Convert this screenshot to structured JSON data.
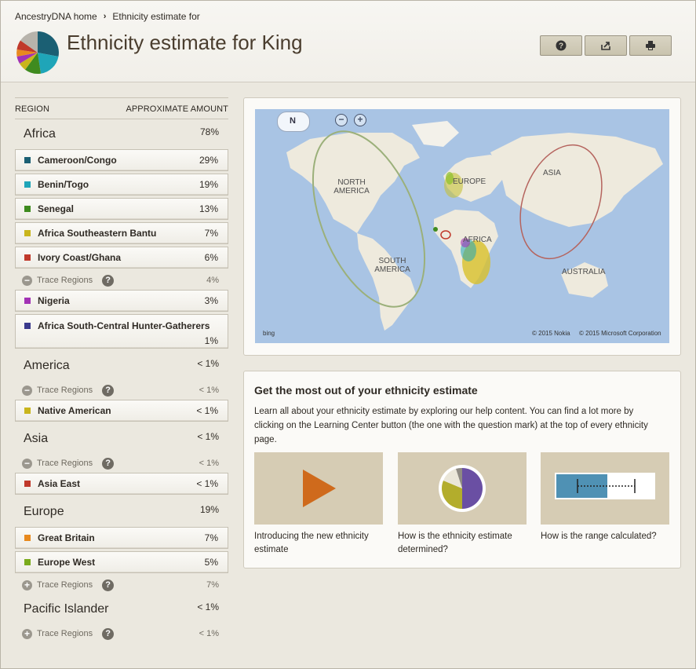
{
  "breadcrumb": {
    "home": "AncestryDNA home",
    "current": "Ethnicity estimate for"
  },
  "header": {
    "title": "Ethnicity estimate for King"
  },
  "table": {
    "col_region": "REGION",
    "col_amount": "APPROXIMATE AMOUNT"
  },
  "regions": {
    "africa": {
      "name": "Africa",
      "pct": "78%"
    },
    "america": {
      "name": "America",
      "pct": "< 1%"
    },
    "asia": {
      "name": "Asia",
      "pct": "< 1%"
    },
    "europe": {
      "name": "Europe",
      "pct": "19%"
    },
    "pacific": {
      "name": "Pacific Islander",
      "pct": "< 1%"
    }
  },
  "subregions": {
    "cameroon": {
      "name": "Cameroon/Congo",
      "pct": "29%",
      "color": "#1b5f73"
    },
    "benin": {
      "name": "Benin/Togo",
      "pct": "19%",
      "color": "#1fa5b8"
    },
    "senegal": {
      "name": "Senegal",
      "pct": "13%",
      "color": "#3f8b1f"
    },
    "bantu": {
      "name": "Africa Southeastern Bantu",
      "pct": "7%",
      "color": "#c9b51c"
    },
    "ivory": {
      "name": "Ivory Coast/Ghana",
      "pct": "6%",
      "color": "#c0392b"
    },
    "nigeria": {
      "name": "Nigeria",
      "pct": "3%",
      "color": "#a233b5"
    },
    "hunter": {
      "name": "Africa South-Central Hunter-Gatherers",
      "pct": "1%",
      "color": "#3b3a8c"
    },
    "native": {
      "name": "Native American",
      "pct": "< 1%",
      "color": "#c9b51c"
    },
    "asia_east": {
      "name": "Asia East",
      "pct": "< 1%",
      "color": "#c0392b"
    },
    "gb": {
      "name": "Great Britain",
      "pct": "7%",
      "color": "#e8891e"
    },
    "europe_west": {
      "name": "Europe West",
      "pct": "5%",
      "color": "#7aab1c"
    }
  },
  "trace": {
    "label": "Trace Regions",
    "africa_pct": "4%",
    "america_pct": "< 1%",
    "asia_pct": "< 1%",
    "europe_pct": "7%",
    "pacific_pct": "< 1%"
  },
  "map": {
    "north_america": "NORTH AMERICA",
    "south_america": "SOUTH AMERICA",
    "europe": "EUROPE",
    "africa": "AFRICA",
    "asia": "ASIA",
    "australia": "AUSTRALIA",
    "nav": "N",
    "bing": "bing",
    "credit_nokia": "© 2015 Nokia",
    "credit_ms": "© 2015 Microsoft Corporation"
  },
  "help": {
    "title": "Get the most out of your ethnicity estimate",
    "text": "Learn all about your ethnicity estimate by exploring our help content. You can find a lot more by clicking on the Learning Center button (the one with the question mark) at the top of every ethnicity page.",
    "tile1": "Introducing the new ethnicity estimate",
    "tile2": "How is the ethnicity estimate determined?",
    "tile3": "How is the range calculated?"
  }
}
